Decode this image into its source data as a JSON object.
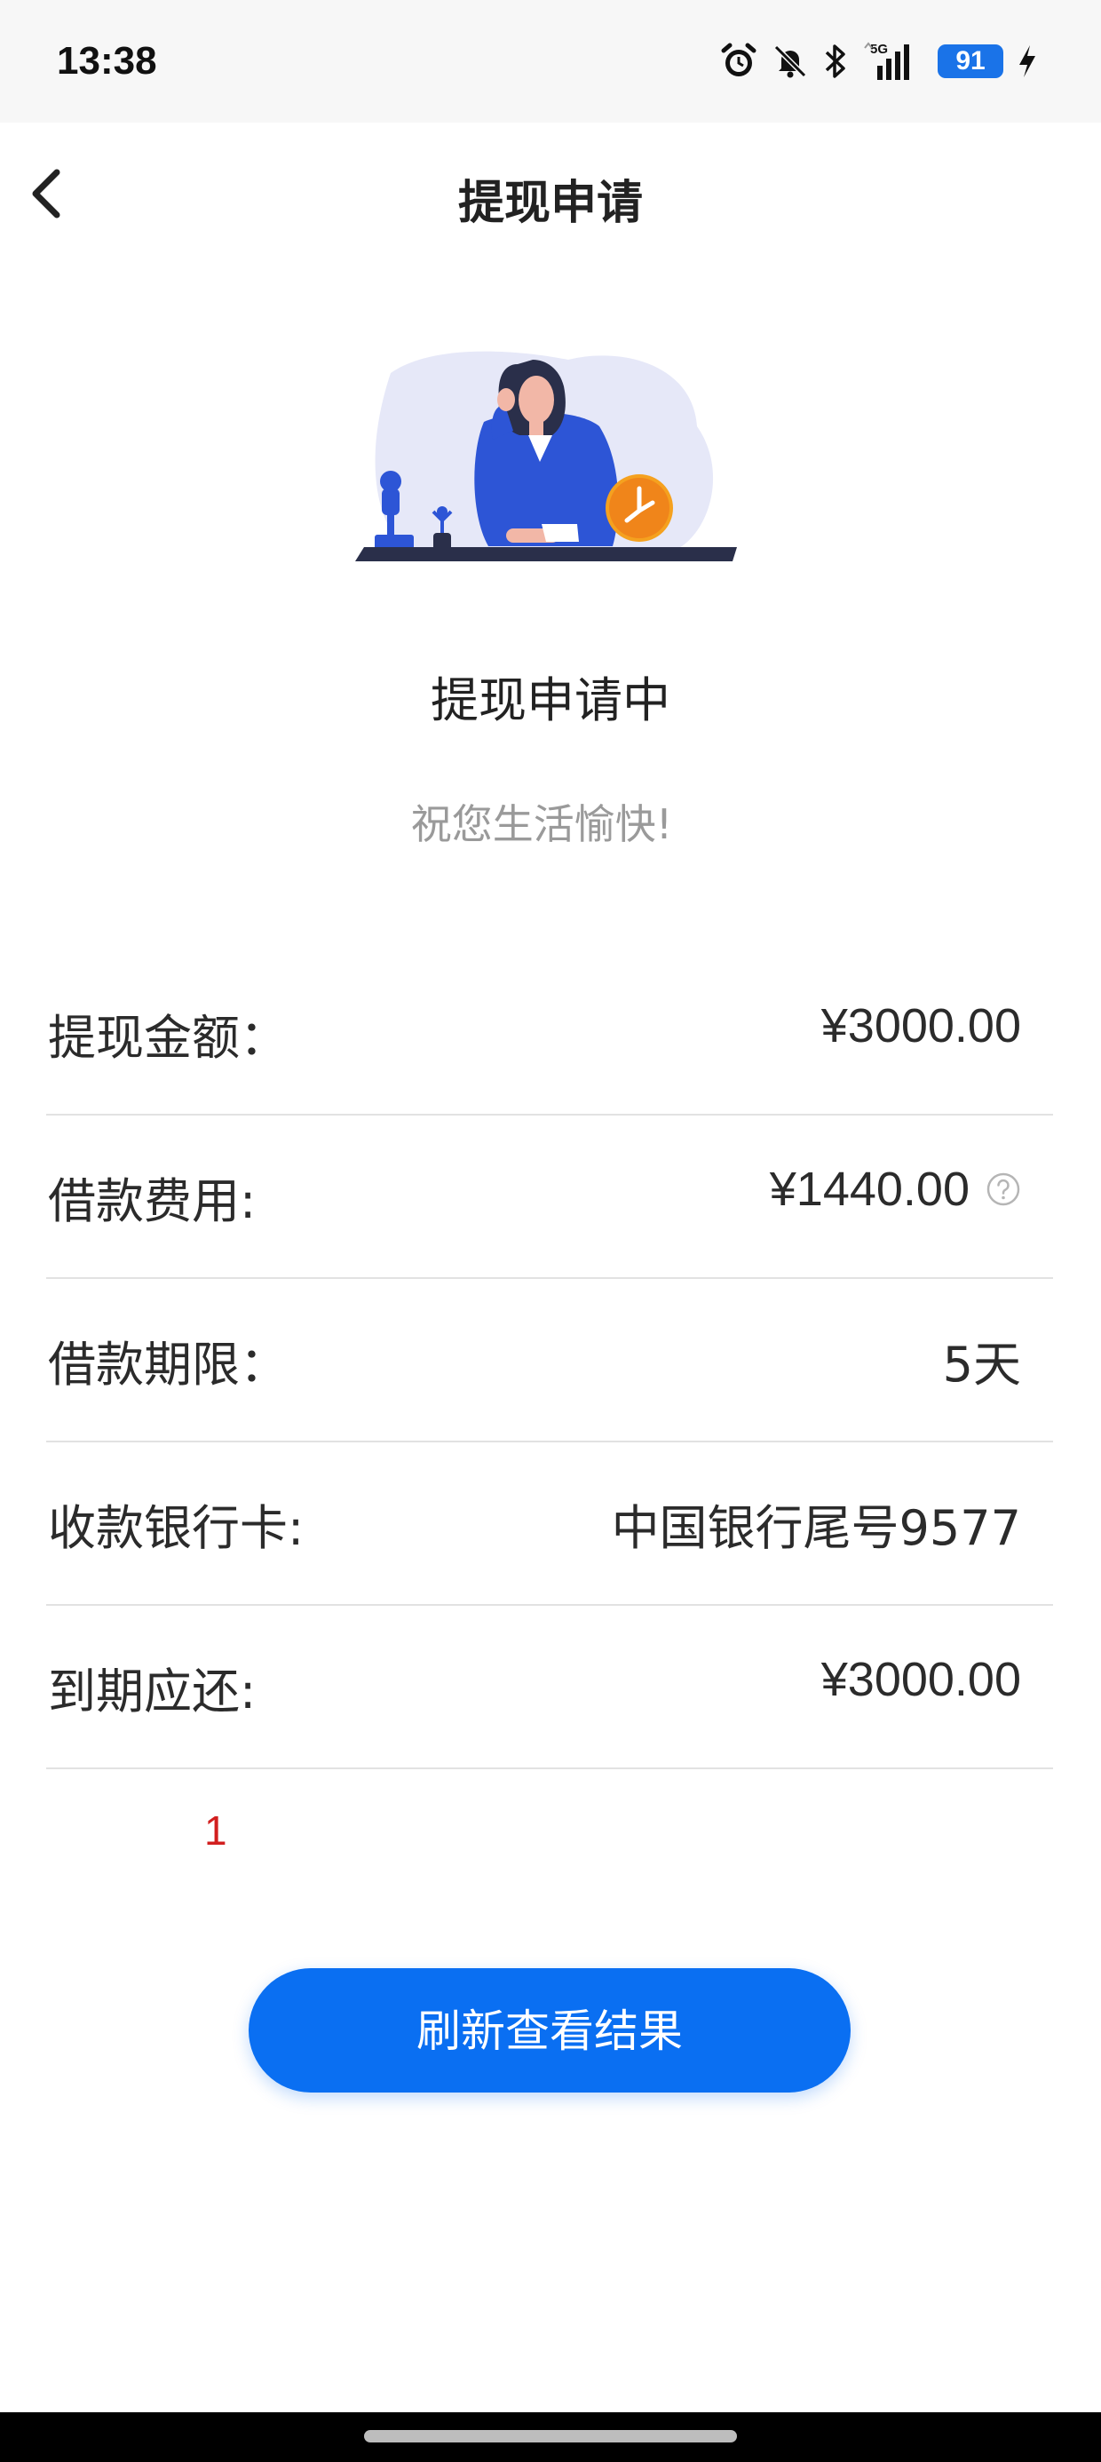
{
  "status_bar": {
    "time": "13:38",
    "icons": [
      "alarm-icon",
      "mute-icon",
      "bluetooth-icon",
      "signal-5g-icon",
      "battery-icon",
      "charging-icon"
    ],
    "network": "5G",
    "battery": "91",
    "battery_color": "#1a73e8"
  },
  "nav": {
    "title": "提现申请",
    "back_icon": "chevron-left-icon"
  },
  "status": {
    "title": "提现申请中",
    "subtitle": "祝您生活愉快!"
  },
  "details": [
    {
      "label": "提现金额：",
      "value": "¥3000.00"
    },
    {
      "label": "借款费用:",
      "value": "¥1440.00",
      "icon": "help-circle-icon"
    },
    {
      "label": "借款期限：",
      "value": "5天"
    },
    {
      "label": "收款银行卡:",
      "value": "中国银行尾号9577"
    },
    {
      "label": "到期应还:",
      "value": "¥3000.00"
    }
  ],
  "note": "1",
  "note_color": "#d21f1f",
  "refresh_button": {
    "label": "刷新查看结果",
    "color": "#0a6ff2"
  }
}
